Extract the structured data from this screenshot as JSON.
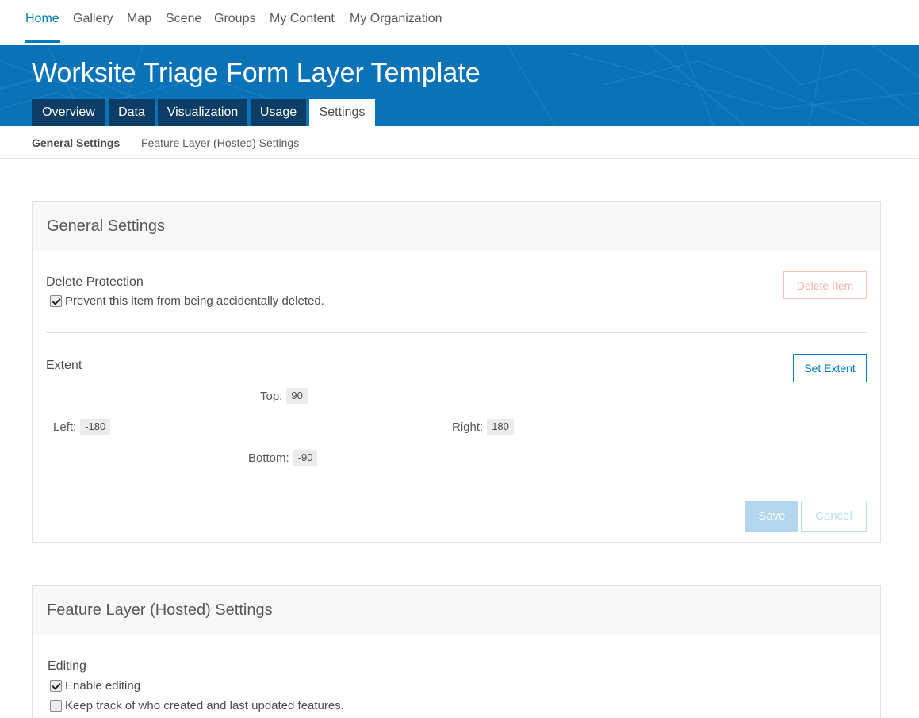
{
  "topnav": {
    "items": [
      {
        "label": "Home"
      },
      {
        "label": "Gallery"
      },
      {
        "label": "Map"
      },
      {
        "label": "Scene"
      },
      {
        "label": "Groups"
      },
      {
        "label": "My Content"
      },
      {
        "label": "My Organization"
      }
    ],
    "active_index": 0
  },
  "banner": {
    "title": "Worksite Triage Form Layer Template",
    "tabs": [
      {
        "label": "Overview"
      },
      {
        "label": "Data"
      },
      {
        "label": "Visualization"
      },
      {
        "label": "Usage"
      },
      {
        "label": "Settings"
      }
    ],
    "active_tab": "Settings"
  },
  "subnav": {
    "items": [
      {
        "label": "General Settings"
      },
      {
        "label": "Feature Layer (Hosted) Settings"
      }
    ],
    "active_index": 0
  },
  "general_settings": {
    "title": "General Settings",
    "delete_protection": {
      "label": "Delete Protection",
      "checkbox_label": "Prevent this item from being accidentally deleted.",
      "checked": true,
      "delete_button": "Delete Item"
    },
    "extent": {
      "label": "Extent",
      "set_extent_button": "Set Extent",
      "top_label": "Top:",
      "top": "90",
      "left_label": "Left:",
      "left": "-180",
      "right_label": "Right:",
      "right": "180",
      "bottom_label": "Bottom:",
      "bottom": "-90"
    },
    "save_button": "Save",
    "cancel_button": "Cancel"
  },
  "feature_layer_settings": {
    "title": "Feature Layer (Hosted) Settings",
    "editing": {
      "label": "Editing",
      "options": [
        {
          "label": "Enable editing",
          "checked": true
        },
        {
          "label": "Keep track of who created and last updated features.",
          "checked": false
        }
      ]
    }
  },
  "colors": {
    "accent": "#0079c1",
    "banner": "#0a73b8",
    "tab_dark": "#0b3d66"
  }
}
